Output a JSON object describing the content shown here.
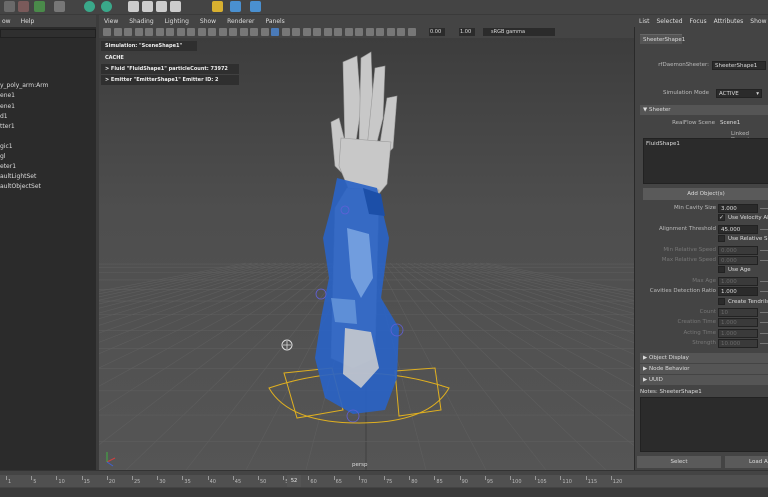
{
  "outliner": {
    "menu": [
      "ow",
      "Help"
    ],
    "items": [
      {
        "label": "",
        "dim": true
      },
      {
        "label": "",
        "dim": true
      },
      {
        "label": "",
        "dim": true
      },
      {
        "label": "",
        "dim": true
      },
      {
        "label": "y_poly_arm:Arm",
        "dim": false
      },
      {
        "label": "ene1",
        "dim": false
      },
      {
        "label": "ene1",
        "dim": false
      },
      {
        "label": "d1",
        "dim": false
      },
      {
        "label": "tter1",
        "dim": false
      },
      {
        "label": "",
        "dim": true
      },
      {
        "label": "gic1",
        "dim": false
      },
      {
        "label": "gl",
        "dim": false
      },
      {
        "label": "eter1",
        "dim": false
      },
      {
        "label": "aultLightSet",
        "dim": false
      },
      {
        "label": "aultObjectSet",
        "dim": false
      }
    ]
  },
  "viewport": {
    "menu": [
      "View",
      "Shading",
      "Lighting",
      "Show",
      "Renderer",
      "Panels"
    ],
    "field_a": "0.00",
    "field_b": "1.00",
    "color_space": "sRGB gamma",
    "hud": {
      "simulation": "Simulation: \"SceneShape1\"",
      "cache_mode": "CACHE MODE",
      "fluid": "> Fluid \"FluidShape1\" particleCount: 73972",
      "emitter": "> Emitter \"EmitterShape1\" Emitter ID: 2"
    },
    "camera": "persp"
  },
  "attribute_editor": {
    "menu": [
      "List",
      "Selected",
      "Focus",
      "Attributes",
      "Show"
    ],
    "node_tab": "SheeterShape1",
    "node_type_label": "rfDaemonSheeter:",
    "node_name": "SheeterShape1",
    "sim_mode_label": "Simulation Mode",
    "sim_mode_value": "ACTIVE",
    "section_sheeter": "Sheeter",
    "realflow_scene_label": "RealFlow Scene",
    "realflow_scene_value": "Scene1",
    "linked_domains_label": "Linked Domains",
    "linked_domain_item": "FluidShape1",
    "add_objects": "Add Object(s)",
    "rows": [
      {
        "label": "Min Cavity Size",
        "type": "field",
        "value": "3.000",
        "dim": false
      },
      {
        "label": "",
        "type": "check",
        "checked": true,
        "check_label": "Use Velocity Alig",
        "dim": false
      },
      {
        "label": "Alignment Threshold",
        "type": "field",
        "value": "45.000",
        "dim": false
      },
      {
        "label": "",
        "type": "check",
        "checked": false,
        "check_label": "Use Relative Spe",
        "dim": false
      },
      {
        "label": "Min Relative Speed",
        "type": "field",
        "value": "0.000",
        "dim": true
      },
      {
        "label": "Max Relative Speed",
        "type": "field",
        "value": "0.000",
        "dim": true
      },
      {
        "label": "",
        "type": "check",
        "checked": false,
        "check_label": "Use Age",
        "dim": false
      },
      {
        "label": "Max Age",
        "type": "field",
        "value": "1.000",
        "dim": true
      },
      {
        "label": "Cavities Detection Ratio",
        "type": "field",
        "value": "1.000",
        "dim": false
      },
      {
        "label": "",
        "type": "check",
        "checked": false,
        "check_label": "Create Tendrils",
        "dim": false
      },
      {
        "label": "Count",
        "type": "field",
        "value": "10",
        "dim": true
      },
      {
        "label": "Creation Time",
        "type": "field",
        "value": "1.000",
        "dim": true
      },
      {
        "label": "Acting Time",
        "type": "field",
        "value": "1.000",
        "dim": true
      },
      {
        "label": "Strength",
        "type": "field",
        "value": "10.000",
        "dim": true
      }
    ],
    "sections_collapsed": [
      "Object Display",
      "Node Behavior",
      "UUID"
    ],
    "notes_label": "Notes:  SheeterShape1",
    "select_button": "Select",
    "load_button": "Load A"
  },
  "timeline": {
    "ticks": [
      "1",
      "5",
      "10",
      "15",
      "20",
      "25",
      "30",
      "35",
      "40",
      "45",
      "50",
      "55",
      "60",
      "65",
      "70",
      "75",
      "80",
      "85",
      "90",
      "95",
      "100",
      "105",
      "110",
      "115",
      "120"
    ],
    "current": "52"
  }
}
